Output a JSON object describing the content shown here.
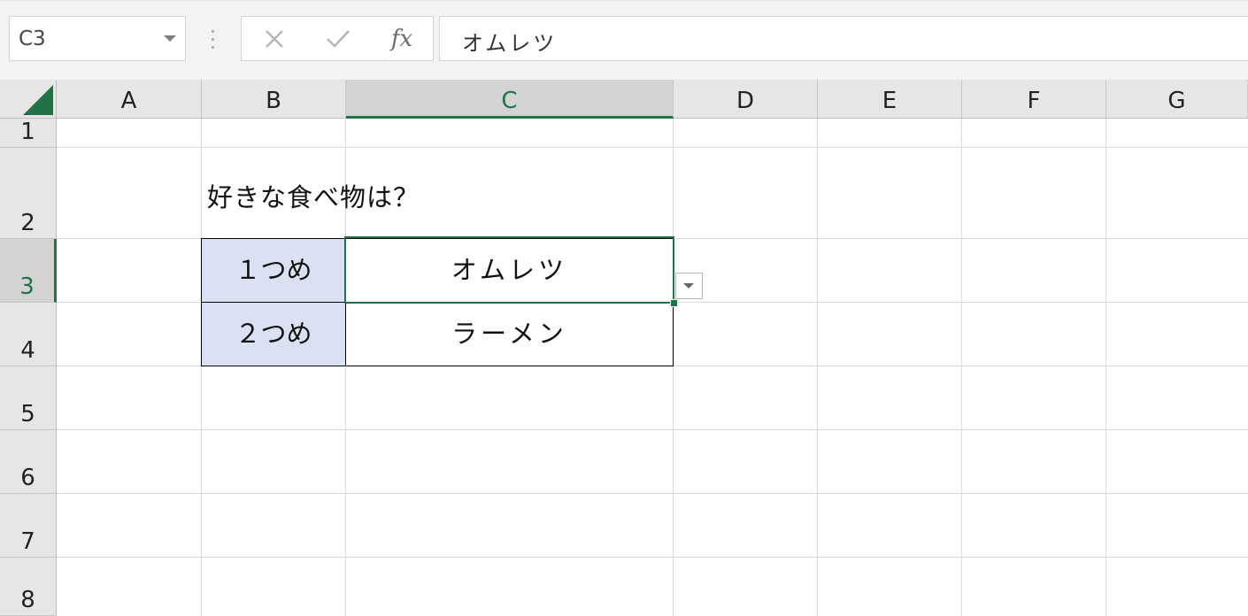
{
  "name_box": {
    "value": "C3",
    "icon": "chevron-down-icon"
  },
  "formula_bar": {
    "cancel_icon": "close-icon",
    "confirm_icon": "check-icon",
    "fx_label": "fx",
    "formula_value": "オムレツ"
  },
  "columns": [
    "A",
    "B",
    "C",
    "D",
    "E",
    "F",
    "G"
  ],
  "rows": [
    "1",
    "2",
    "3",
    "4",
    "5",
    "6",
    "7",
    "8"
  ],
  "selection": {
    "column": "C",
    "row": "3"
  },
  "cells": {
    "B2": "好きな食べ物は？",
    "B3": "１つめ",
    "C3": "オムレツ",
    "B4": "２つめ",
    "C4": "ラーメン"
  },
  "colors": {
    "accent": "#217346",
    "label_fill": "#d9e1f2",
    "header_bg": "#e6e6e6",
    "header_selected_bg": "#d3d3d3"
  }
}
